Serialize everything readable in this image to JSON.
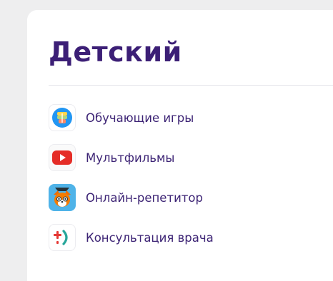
{
  "section": {
    "title": "Детский"
  },
  "items": [
    {
      "label": "Обучающие игры",
      "icon": "education-games-icon"
    },
    {
      "label": "Мультфильмы",
      "icon": "youtube-play-icon"
    },
    {
      "label": "Онлайн-репетитор",
      "icon": "fox-tutor-icon"
    },
    {
      "label": "Консультация врача",
      "icon": "doctor-plus-icon"
    }
  ],
  "colors": {
    "title": "#3c1f76",
    "label": "#3d2475",
    "background": "#eeeeef",
    "card": "#ffffff"
  }
}
